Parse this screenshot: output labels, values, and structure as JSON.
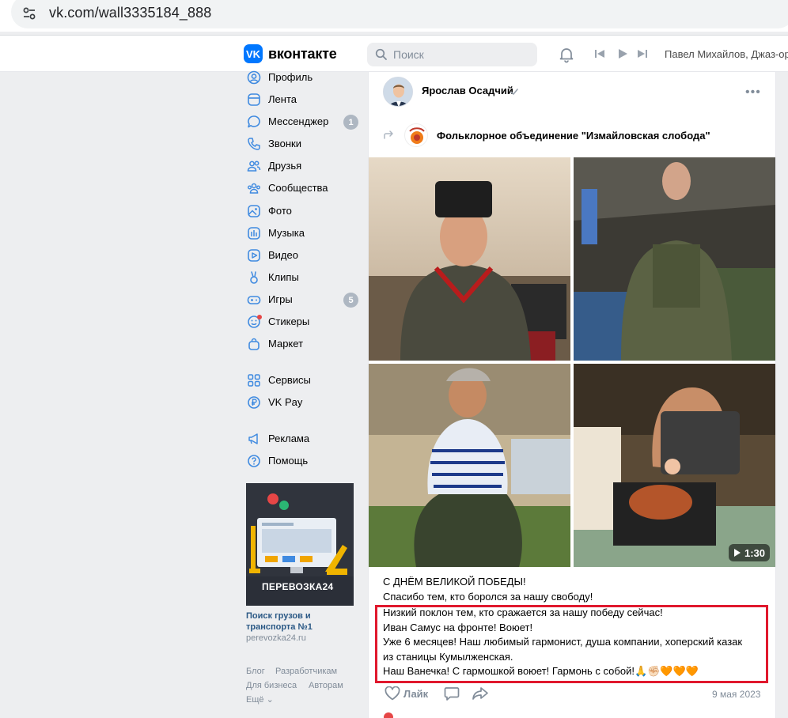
{
  "browser": {
    "url": "vk.com/wall3335184_888"
  },
  "header": {
    "logo_glyph": "VK",
    "brand": "вконтакте",
    "search_placeholder": "Поиск",
    "player_track": "Павел Михайлов, Джаз-ор"
  },
  "nav": {
    "items": [
      {
        "label": "Профиль",
        "icon": "profile-icon"
      },
      {
        "label": "Лента",
        "icon": "feed-icon"
      },
      {
        "label": "Мессенджер",
        "icon": "messenger-icon",
        "badge": "1"
      },
      {
        "label": "Звонки",
        "icon": "phone-icon"
      },
      {
        "label": "Друзья",
        "icon": "friends-icon"
      },
      {
        "label": "Сообщества",
        "icon": "communities-icon"
      },
      {
        "label": "Фото",
        "icon": "photo-icon"
      },
      {
        "label": "Музыка",
        "icon": "music-icon"
      },
      {
        "label": "Видео",
        "icon": "video-icon"
      },
      {
        "label": "Клипы",
        "icon": "clips-icon"
      },
      {
        "label": "Игры",
        "icon": "games-icon",
        "badge": "5"
      },
      {
        "label": "Стикеры",
        "icon": "stickers-icon"
      },
      {
        "label": "Маркет",
        "icon": "market-icon"
      },
      {
        "label": "Сервисы",
        "icon": "services-icon"
      },
      {
        "label": "VK Pay",
        "icon": "vkpay-icon"
      },
      {
        "label": "Реклама",
        "icon": "ads-icon"
      },
      {
        "label": "Помощь",
        "icon": "help-icon"
      }
    ]
  },
  "ad": {
    "banner_text": "ПЕРЕВОЗКА24",
    "title": "Поиск грузов и транспорта №1",
    "site": "perevozka24.ru"
  },
  "footer": {
    "blog": "Блог",
    "developers": "Разработчикам",
    "business": "Для бизнеса",
    "authors": "Авторам",
    "more": "Ещё"
  },
  "post": {
    "author": "Ярослав Осадчий",
    "group": "Фольклорное объединение \"Измайловская слобода\"",
    "video_duration": "1:30",
    "lines": [
      "С ДНЁМ ВЕЛИКОЙ ПОБЕДЫ!",
      "Спасибо тем, кто боролся за нашу свободу!",
      "Низкий поклон тем, кто сражается за нашу победу сейчас!",
      "Иван Самус на фронте! Воюет!",
      "Уже 6 месяцев! Наш любимый гармонист, душа компании, хоперский казак",
      "из станицы Кумылженская.",
      "Наш Ванечка! С гармошкой воюет! Гармонь с собой!🙏✊🏻🧡🧡🧡"
    ],
    "like_label": "Лайк",
    "date": "9 мая 2023"
  }
}
